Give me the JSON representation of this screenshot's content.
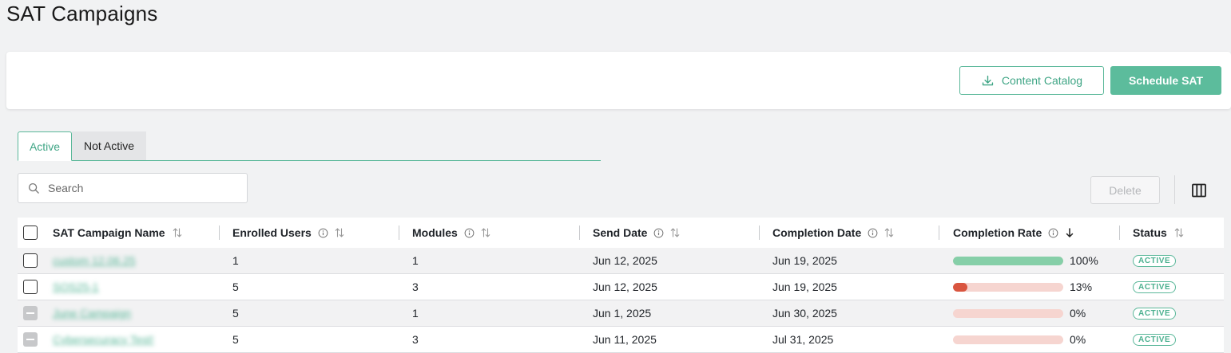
{
  "page": {
    "title": "SAT Campaigns"
  },
  "actions": {
    "content_catalog_label": "Content Catalog",
    "schedule_label": "Schedule SAT"
  },
  "tabs": [
    {
      "label": "Active",
      "selected": true
    },
    {
      "label": "Not Active",
      "selected": false
    }
  ],
  "search": {
    "placeholder": "Search",
    "value": ""
  },
  "toolbar": {
    "delete_label": "Delete",
    "delete_enabled": false,
    "columns_icon": "columns-icon"
  },
  "table": {
    "columns": [
      {
        "label": "SAT Campaign Name",
        "info": false,
        "sort": "none"
      },
      {
        "label": "Enrolled Users",
        "info": true,
        "sort": "none"
      },
      {
        "label": "Modules",
        "info": true,
        "sort": "none"
      },
      {
        "label": "Send Date",
        "info": true,
        "sort": "none"
      },
      {
        "label": "Completion Date",
        "info": true,
        "sort": "none"
      },
      {
        "label": "Completion Rate",
        "info": true,
        "sort": "desc"
      },
      {
        "label": "Status",
        "info": false,
        "sort": "none"
      }
    ],
    "rows": [
      {
        "name": "custom 12.06.25",
        "enrolled": "1",
        "modules": "1",
        "send_date": "Jun 12, 2025",
        "completion_date": "Jun 19, 2025",
        "rate": 100,
        "rate_label": "100%",
        "status": "ACTIVE",
        "checkbox_enabled": true
      },
      {
        "name": "SOS25-1",
        "enrolled": "5",
        "modules": "3",
        "send_date": "Jun 12, 2025",
        "completion_date": "Jun 19, 2025",
        "rate": 13,
        "rate_label": "13%",
        "status": "ACTIVE",
        "checkbox_enabled": true
      },
      {
        "name": "June Campaign",
        "enrolled": "5",
        "modules": "1",
        "send_date": "Jun 1, 2025",
        "completion_date": "Jun 30, 2025",
        "rate": 0,
        "rate_label": "0%",
        "status": "ACTIVE",
        "checkbox_enabled": false
      },
      {
        "name": "Cybersecuracy Test!",
        "enrolled": "5",
        "modules": "3",
        "send_date": "Jun 11, 2025",
        "completion_date": "Jul 31, 2025",
        "rate": 0,
        "rate_label": "0%",
        "status": "ACTIVE",
        "checkbox_enabled": false
      }
    ]
  },
  "colors": {
    "accent": "#5cbc9c",
    "bar_complete": "#86cfa8",
    "bar_low": "#d9553f",
    "bar_track": "#f6d5d0"
  }
}
